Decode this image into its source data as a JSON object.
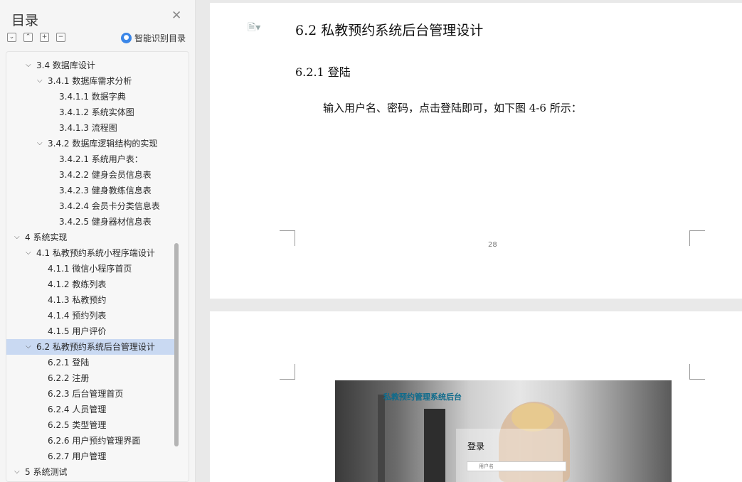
{
  "sidebar": {
    "title": "目录",
    "smart_label": "智能识别目录",
    "toc": [
      {
        "level": 1,
        "label": "3.4 数据库设计",
        "expanded": true
      },
      {
        "level": 2,
        "label": "3.4.1 数据库需求分析",
        "expanded": true
      },
      {
        "level": 3,
        "label": "3.4.1.1 数据字典"
      },
      {
        "level": 3,
        "label": "3.4.1.2 系统实体图"
      },
      {
        "level": 3,
        "label": "3.4.1.3 流程图"
      },
      {
        "level": 2,
        "label": "3.4.2 数据库逻辑结构的实现",
        "expanded": true
      },
      {
        "level": 3,
        "label": "3.4.2.1  系统用户表："
      },
      {
        "level": 3,
        "label": "3.4.2.2 健身会员信息表"
      },
      {
        "level": 3,
        "label": "3.4.2.3 健身教练信息表"
      },
      {
        "level": 3,
        "label": "3.4.2.4 会员卡分类信息表"
      },
      {
        "level": 3,
        "label": "3.4.2.5 健身器材信息表"
      },
      {
        "level": 0,
        "label": "4 系统实现",
        "expanded": true
      },
      {
        "level": 1,
        "label": "4.1 私教预约系统小程序端设计",
        "expanded": true
      },
      {
        "level": 2,
        "label": "4.1.1 微信小程序首页"
      },
      {
        "level": 2,
        "label": "4.1.2 教练列表"
      },
      {
        "level": 2,
        "label": "4.1.3 私教预约"
      },
      {
        "level": 2,
        "label": "4.1.4 预约列表"
      },
      {
        "level": 2,
        "label": "4.1.5 用户评价"
      },
      {
        "level": 1,
        "label": "6.2  私教预约系统后台管理设计",
        "expanded": true,
        "selected": true
      },
      {
        "level": 2,
        "label": "6.2.1 登陆"
      },
      {
        "level": 2,
        "label": "6.2.2 注册"
      },
      {
        "level": 2,
        "label": "6.2.3 后台管理首页"
      },
      {
        "level": 2,
        "label": "6.2.4 人员管理"
      },
      {
        "level": 2,
        "label": "6.2.5 类型管理"
      },
      {
        "level": 2,
        "label": "6.2.6 用户预约管理界面"
      },
      {
        "level": 2,
        "label": "6.2.7 用户管理"
      },
      {
        "level": 0,
        "label": "5 系统测试",
        "expanded": true
      }
    ]
  },
  "document": {
    "heading2": "6.2  私教预约系统后台管理设计",
    "heading3": "6.2.1 登陆",
    "paragraph": "输入用户名、密码，点击登陆即可，如下图 4-6 所示：",
    "page_number": "28",
    "screenshot": {
      "title": "私教预约管理系统后台",
      "login_title": "登录",
      "username_placeholder": "用户名"
    }
  },
  "colors": {
    "selected_bg": "#c9d9f2",
    "smart_icon": "#3a86e8"
  }
}
